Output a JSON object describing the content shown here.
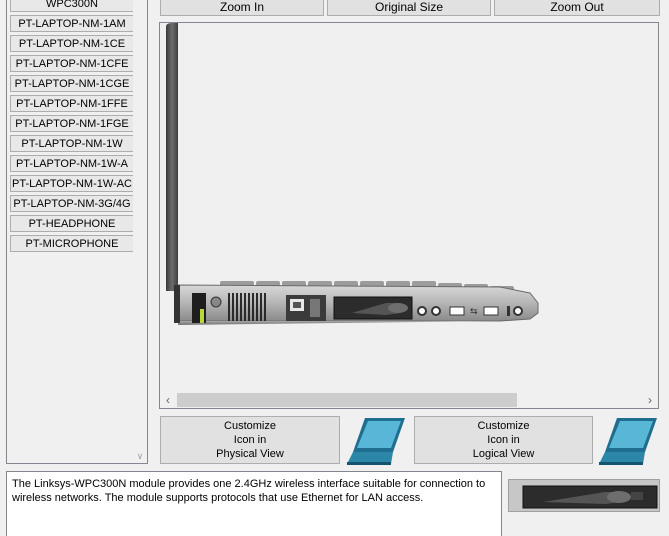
{
  "module_list": {
    "items": [
      "WPC300N",
      "PT-LAPTOP-NM-1AM",
      "PT-LAPTOP-NM-1CE",
      "PT-LAPTOP-NM-1CFE",
      "PT-LAPTOP-NM-1CGE",
      "PT-LAPTOP-NM-1FFE",
      "PT-LAPTOP-NM-1FGE",
      "PT-LAPTOP-NM-1W",
      "PT-LAPTOP-NM-1W-A",
      "PT-LAPTOP-NM-1W-AC",
      "PT-LAPTOP-NM-3G/4G",
      "PT-HEADPHONE",
      "PT-MICROPHONE"
    ]
  },
  "zoom": {
    "zoom_in": "Zoom In",
    "original_size": "Original Size",
    "zoom_out": "Zoom Out"
  },
  "customize": {
    "physical": {
      "line1": "Customize",
      "line2": "Icon in",
      "line3": "Physical View"
    },
    "logical": {
      "line1": "Customize",
      "line2": "Icon in",
      "line3": "Logical View"
    }
  },
  "description": "The Linksys-WPC300N module provides one 2.4GHz wireless interface suitable for connection to wireless networks. The module supports protocols that use Ethernet for LAN access.",
  "icons": {
    "laptop": "laptop-icon",
    "scroll_left": "chevron-left-icon",
    "scroll_right": "chevron-right-icon",
    "scroll_down": "chevron-down-icon"
  }
}
